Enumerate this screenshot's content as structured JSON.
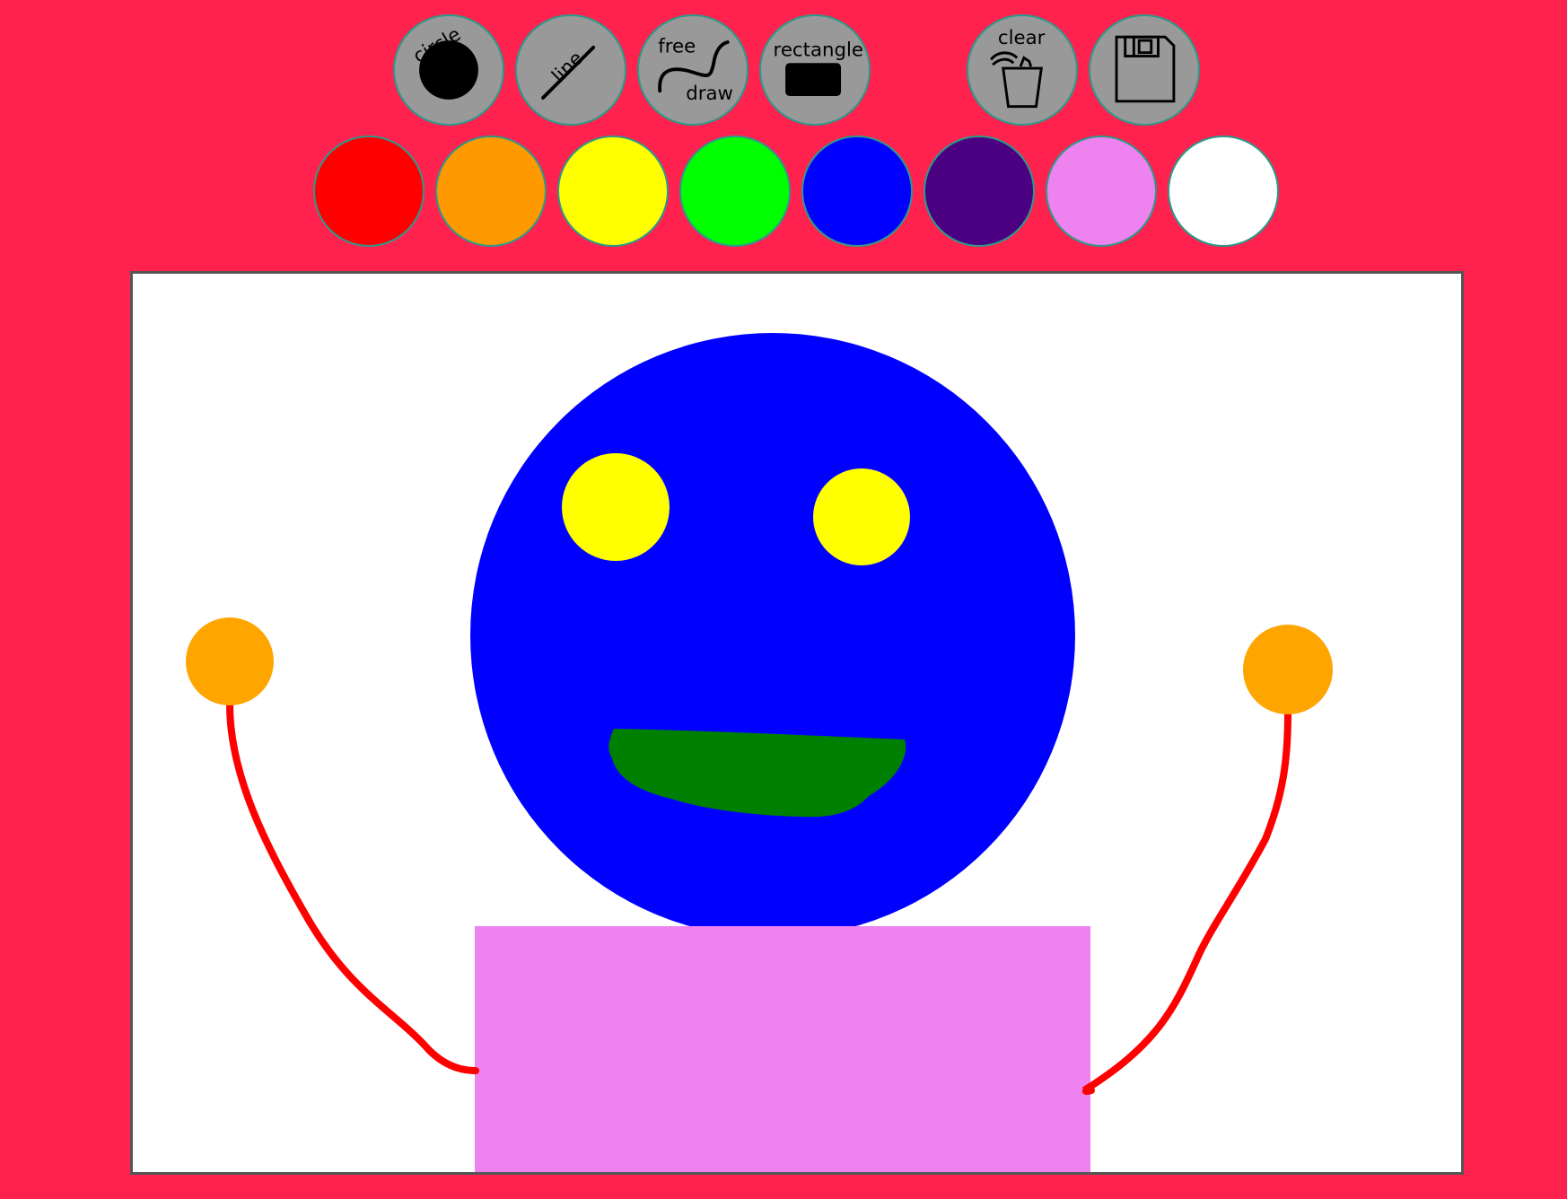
{
  "toolbar": {
    "tools": [
      {
        "id": "circle",
        "label": "circle",
        "icon": "circle-icon"
      },
      {
        "id": "line",
        "label": "line",
        "icon": "line-icon"
      },
      {
        "id": "free-draw",
        "label_top": "free",
        "label_bottom": "draw",
        "icon": "squiggle-icon"
      },
      {
        "id": "rectangle",
        "label": "rectangle",
        "icon": "rectangle-icon"
      },
      {
        "id": "clear",
        "label": "clear",
        "icon": "trash-icon"
      },
      {
        "id": "save",
        "icon": "floppy-disk-icon"
      }
    ]
  },
  "palette": {
    "colors": [
      {
        "name": "red",
        "hex": "#FF0000"
      },
      {
        "name": "orange",
        "hex": "#FF9900"
      },
      {
        "name": "yellow",
        "hex": "#FFFF00"
      },
      {
        "name": "green",
        "hex": "#00FF00"
      },
      {
        "name": "blue",
        "hex": "#0000FF"
      },
      {
        "name": "purple",
        "hex": "#4B0082"
      },
      {
        "name": "violet",
        "hex": "#EE82EE"
      },
      {
        "name": "white",
        "hex": "#FFFFFF"
      }
    ]
  },
  "drawing": {
    "colors": {
      "head": "#0000FF",
      "eyes": "#FFFF00",
      "mouth": "#008000",
      "hands": "#FFA500",
      "arms": "#FF0000",
      "body": "#EE82EE",
      "background": "#FF224F"
    }
  }
}
